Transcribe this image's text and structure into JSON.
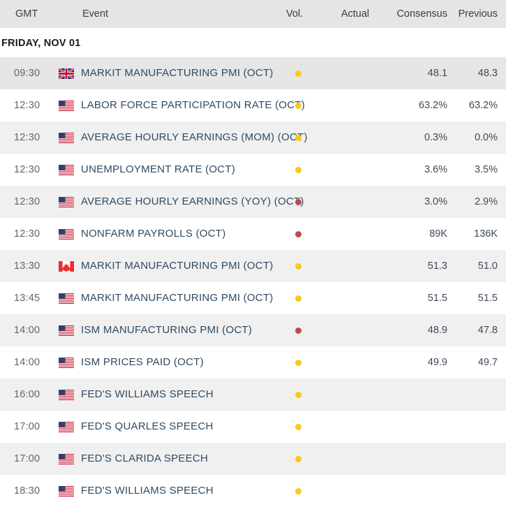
{
  "table": {
    "columns": {
      "time": "GMT",
      "event": "Event",
      "volatility": "Vol.",
      "actual": "Actual",
      "consensus": "Consensus",
      "previous": "Previous"
    },
    "date_group": "FRIDAY, NOV 01",
    "colors": {
      "volatility_medium": "#f7c81e",
      "volatility_high": "#c04a46",
      "event_text": "#2e4a63",
      "header_background": "#e5e5e5",
      "row_stripe": "#f0f0f0"
    },
    "rows": [
      {
        "time": "09:30",
        "flag": "flag-uk-icon",
        "country": "United Kingdom",
        "event": "MARKIT MANUFACTURING PMI (OCT)",
        "volatility": "medium",
        "actual": "",
        "consensus": "48.1",
        "previous": "48.3"
      },
      {
        "time": "12:30",
        "flag": "flag-us-icon",
        "country": "United States",
        "event": "LABOR FORCE PARTICIPATION RATE (OCT)",
        "volatility": "medium",
        "actual": "",
        "consensus": "63.2%",
        "previous": "63.2%"
      },
      {
        "time": "12:30",
        "flag": "flag-us-icon",
        "country": "United States",
        "event": "AVERAGE HOURLY EARNINGS (MOM) (OCT)",
        "volatility": "medium",
        "actual": "",
        "consensus": "0.3%",
        "previous": "0.0%"
      },
      {
        "time": "12:30",
        "flag": "flag-us-icon",
        "country": "United States",
        "event": "UNEMPLOYMENT RATE (OCT)",
        "volatility": "medium",
        "actual": "",
        "consensus": "3.6%",
        "previous": "3.5%"
      },
      {
        "time": "12:30",
        "flag": "flag-us-icon",
        "country": "United States",
        "event": "AVERAGE HOURLY EARNINGS (YOY) (OCT)",
        "volatility": "high",
        "actual": "",
        "consensus": "3.0%",
        "previous": "2.9%"
      },
      {
        "time": "12:30",
        "flag": "flag-us-icon",
        "country": "United States",
        "event": "NONFARM PAYROLLS (OCT)",
        "volatility": "high",
        "actual": "",
        "consensus": "89K",
        "previous": "136K"
      },
      {
        "time": "13:30",
        "flag": "flag-ca-icon",
        "country": "Canada",
        "event": "MARKIT MANUFACTURING PMI (OCT)",
        "volatility": "medium",
        "actual": "",
        "consensus": "51.3",
        "previous": "51.0"
      },
      {
        "time": "13:45",
        "flag": "flag-us-icon",
        "country": "United States",
        "event": "MARKIT MANUFACTURING PMI (OCT)",
        "volatility": "medium",
        "actual": "",
        "consensus": "51.5",
        "previous": "51.5"
      },
      {
        "time": "14:00",
        "flag": "flag-us-icon",
        "country": "United States",
        "event": "ISM MANUFACTURING PMI (OCT)",
        "volatility": "high",
        "actual": "",
        "consensus": "48.9",
        "previous": "47.8"
      },
      {
        "time": "14:00",
        "flag": "flag-us-icon",
        "country": "United States",
        "event": "ISM PRICES PAID (OCT)",
        "volatility": "medium",
        "actual": "",
        "consensus": "49.9",
        "previous": "49.7"
      },
      {
        "time": "16:00",
        "flag": "flag-us-icon",
        "country": "United States",
        "event": "FED'S WILLIAMS SPEECH",
        "volatility": "medium",
        "actual": "",
        "consensus": "",
        "previous": ""
      },
      {
        "time": "17:00",
        "flag": "flag-us-icon",
        "country": "United States",
        "event": "FED'S QUARLES SPEECH",
        "volatility": "medium",
        "actual": "",
        "consensus": "",
        "previous": ""
      },
      {
        "time": "17:00",
        "flag": "flag-us-icon",
        "country": "United States",
        "event": "FED'S CLARIDA SPEECH",
        "volatility": "medium",
        "actual": "",
        "consensus": "",
        "previous": ""
      },
      {
        "time": "18:30",
        "flag": "flag-us-icon",
        "country": "United States",
        "event": "FED'S WILLIAMS SPEECH",
        "volatility": "medium",
        "actual": "",
        "consensus": "",
        "previous": ""
      }
    ]
  }
}
